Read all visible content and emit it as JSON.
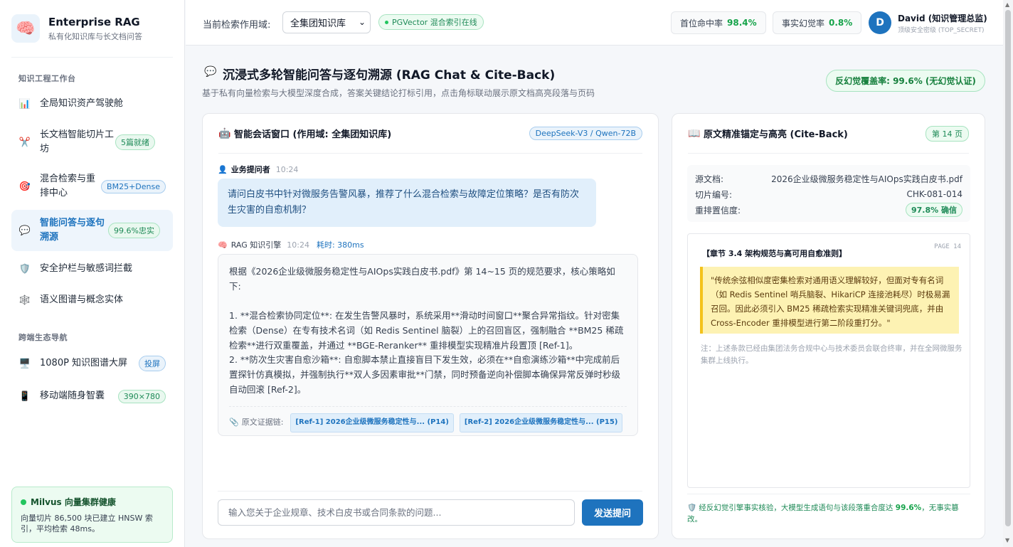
{
  "brand": {
    "logo": "🧠",
    "name": "Enterprise RAG",
    "subtitle": "私有化知识库与长文档问答"
  },
  "sidebar": {
    "section1": "知识工程工作台",
    "section2": "跨端生态导航",
    "items": [
      {
        "icon": "📊",
        "label": "全局知识资产驾驶舱",
        "badge": ""
      },
      {
        "icon": "✂️",
        "label": "长文档智能切片工坊",
        "badge": "5篇就绪"
      },
      {
        "icon": "🎯",
        "label": "混合检索与重排中心",
        "badge": "BM25+Dense"
      },
      {
        "icon": "💬",
        "label": "智能问答与逐句溯源",
        "badge": "99.6%忠实"
      },
      {
        "icon": "🛡️",
        "label": "安全护栏与敏感词拦截",
        "badge": ""
      },
      {
        "icon": "🕸️",
        "label": "语义图谱与概念实体",
        "badge": ""
      }
    ],
    "eco_items": [
      {
        "icon": "🖥️",
        "label": "1080P 知识图谱大屏",
        "badge": "投屏"
      },
      {
        "icon": "📱",
        "label": "移动端随身智囊",
        "badge": "390×780"
      }
    ],
    "health": {
      "title": "Milvus 向量集群健康",
      "desc": "向量切片 86,500 块已建立 HNSW 索引，平均检索 48ms。"
    }
  },
  "topbar": {
    "scope_label": "当前检索作用域:",
    "scope_value": "全集团知识库",
    "pg_status": "PGVector 混合索引在线",
    "metric1_label": "首位命中率",
    "metric1_value": "98.4%",
    "metric2_label": "事实幻觉率",
    "metric2_value": "0.8%",
    "avatar_letter": "D",
    "user_name": "David (知识管理总监)",
    "user_clearance": "顶级安全密级 (TOP_SECRET)"
  },
  "page": {
    "icon": "💬",
    "title": "沉浸式多轮智能问答与逐句溯源 (RAG Chat & Cite-Back)",
    "subtitle": "基于私有向量检索与大模型深度合成，答案关键结论打标引用，点击角标联动展示原文档高亮段落与页码",
    "coverage": "反幻觉覆盖率: 99.6% (无幻觉认证)"
  },
  "chat": {
    "icon": "🤖",
    "title": "智能会话窗口 (作用域: 全集团知识库)",
    "model": "DeepSeek-V3 / Qwen-72B",
    "user": {
      "icon": "👤",
      "name": "业务提问者",
      "time": "10:24",
      "text": "请问白皮书中针对微服务告警风暴，推荐了什么混合检索与故障定位策略？是否有防次生灾害的自愈机制？"
    },
    "bot": {
      "icon": "🧠",
      "name": "RAG 知识引擎",
      "time": "10:24",
      "cost": "耗时: 380ms",
      "intro": "根据《2026企业级微服务稳定性与AIOps实践白皮书.pdf》第 14~15 页的规范要求，核心策略如下:",
      "p1": "1. **混合检索协同定位**: 在发生告警风暴时，系统采用**滑动时间窗口**聚合异常指纹。针对密集检索（Dense）在专有技术名词（如 Redis Sentinel 脑裂）上的召回盲区，强制融合 **BM25 稀疏检索**进行双重覆盖，并通过 **BGE-Reranker** 重排模型实现精准片段置顶 [Ref-1]。",
      "p2": "2. **防次生灾害自愈沙箱**: 自愈脚本禁止直接盲目下发生效，必须在**自愈演练沙箱**中完成前后置探针仿真模拟，并强制执行**双人多因素审批**门禁，同时预备逆向补偿脚本确保异常反弹时秒级自动回滚 [Ref-2]。",
      "ref_label": "原文证据链:",
      "ref1": "[Ref-1] 2026企业级微服务稳定性与... (P14)",
      "ref2": "[Ref-2] 2026企业级微服务稳定性与... (P15)"
    },
    "input_placeholder": "输入您关于企业规章、技术白皮书或合同条款的问题...",
    "send_label": "发送提问"
  },
  "cite": {
    "icon": "📖",
    "title": "原文精准锚定与高亮 (Cite-Back)",
    "page_badge": "第 14 页",
    "doc_label": "源文档:",
    "doc_value": "2026企业级微服务稳定性与AIOps实践白皮书.pdf",
    "chunk_label": "切片编号:",
    "chunk_value": "CHK-081-014",
    "conf_label": "重排置信度:",
    "conf_value": "97.8% 确信",
    "section": "【章节 3.4 架构规范与高可用自愈准则】",
    "page_tag": "PAGE 14",
    "quote": "\"传统余弦相似度密集检索对通用语义理解较好，但面对专有名词（如 Redis Sentinel 哨兵脑裂、HikariCP 连接池耗尽）时极易漏召回。因此必须引入 BM25 稀疏检索实现精准关键词兜底，并由 Cross-Encoder 重排模型进行第二阶段重打分。\"",
    "note": "注：上述条款已经由集团法务合规中心与技术委员会联合终审，并在全网微服务集群上线执行。",
    "verify_icon": "🛡️",
    "verify_pre": "经反幻觉引擎事实核验，大模型生成语句与该段落重合度达",
    "verify_pct": "99.6%",
    "verify_post": "，无事实篡改。"
  },
  "colors": {
    "accent": "#1e73be",
    "success": "#16a34a",
    "highlight": "#fdf2b3"
  }
}
